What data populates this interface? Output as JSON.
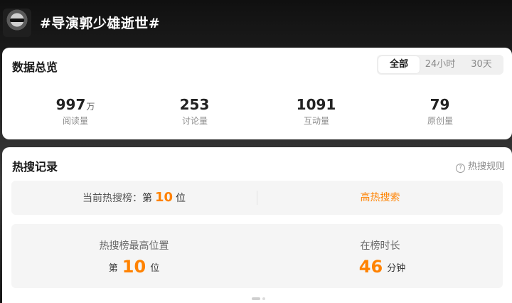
{
  "header": {
    "title": "#导演郭少雄逝世#"
  },
  "overview": {
    "title": "数据总览",
    "tabs": [
      {
        "label": "全部",
        "active": true
      },
      {
        "label": "24小时",
        "active": false
      },
      {
        "label": "30天",
        "active": false
      }
    ],
    "stats": [
      {
        "value": "997",
        "unit": "万",
        "label": "阅读量"
      },
      {
        "value": "253",
        "unit": "",
        "label": "讨论量"
      },
      {
        "value": "1091",
        "unit": "",
        "label": "互动量"
      },
      {
        "value": "79",
        "unit": "",
        "label": "原创量"
      }
    ]
  },
  "hot_search": {
    "title": "热搜记录",
    "rules_label": "热搜规则",
    "help_glyph": "?",
    "current_rank": {
      "prefix": "当前热搜榜：",
      "pre": "第",
      "rank": "10",
      "post": "位"
    },
    "hot_tag": "高热搜索",
    "highest": {
      "label": "热搜榜最高位置",
      "pre": "第",
      "rank": "10",
      "post": "位"
    },
    "duration": {
      "label": "在榜时长",
      "value": "46",
      "unit": "分钟"
    }
  },
  "colors": {
    "accent": "#ff8200",
    "panel": "#f5f5f5"
  }
}
